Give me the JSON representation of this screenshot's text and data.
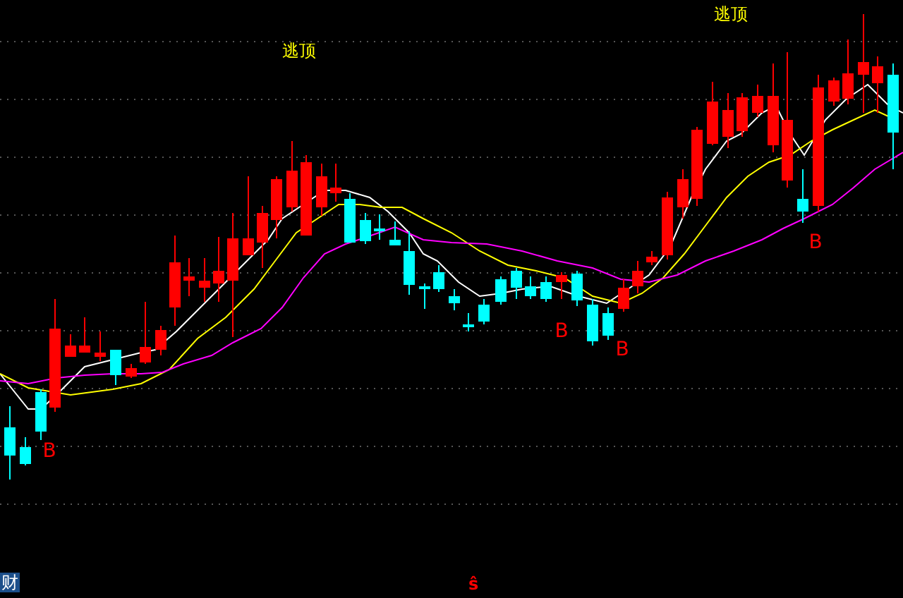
{
  "chart": {
    "signals": [
      {
        "kind": "sell",
        "label": "逃顶"
      },
      {
        "kind": "sell",
        "label": "逃顶"
      },
      {
        "kind": "buy",
        "label": "B"
      },
      {
        "kind": "buy",
        "label": "B"
      },
      {
        "kind": "buy",
        "label": "B"
      },
      {
        "kind": "buy",
        "label": "B"
      }
    ]
  },
  "footer": {
    "tab": "财",
    "marker": "ŝ"
  }
}
